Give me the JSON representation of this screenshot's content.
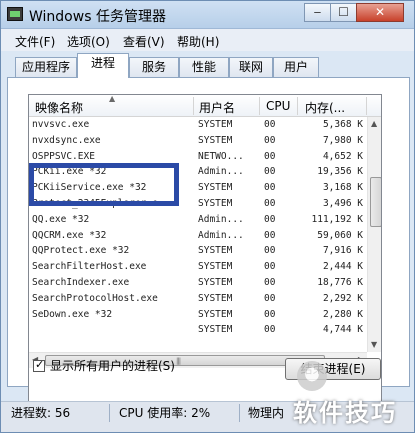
{
  "window": {
    "title": "Windows 任务管理器",
    "min": "‒",
    "max": "☐",
    "close": "✕"
  },
  "menu": [
    "文件(F)",
    "选项(O)",
    "查看(V)",
    "帮助(H)"
  ],
  "tabs": [
    "应用程序",
    "进程",
    "服务",
    "性能",
    "联网",
    "用户"
  ],
  "active_tab": "进程",
  "columns": [
    "映像名称",
    "用户名",
    "CPU",
    "内存(..."
  ],
  "rows": [
    [
      "nvvsvc.exe",
      "SYSTEM",
      "00",
      "5,368 K"
    ],
    [
      "nvxdsync.exe",
      "SYSTEM",
      "00",
      "7,980 K"
    ],
    [
      "OSPPSVC.EXE",
      "NETWO...",
      "00",
      "4,652 K"
    ],
    [
      "PCKii.exe *32",
      "Admin...",
      "00",
      "19,356 K"
    ],
    [
      "PCKiiService.exe *32",
      "SYSTEM",
      "00",
      "3,168 K"
    ],
    [
      "Protect_2345Explorer.e...",
      "SYSTEM",
      "00",
      "3,496 K"
    ],
    [
      "QQ.exe *32",
      "Admin...",
      "00",
      "111,192 K"
    ],
    [
      "QQCRM.exe *32",
      "Admin...",
      "00",
      "59,060 K"
    ],
    [
      "QQProtect.exe *32",
      "SYSTEM",
      "00",
      "7,916 K"
    ],
    [
      "SearchFilterHost.exe",
      "SYSTEM",
      "00",
      "2,444 K"
    ],
    [
      "SearchIndexer.exe",
      "SYSTEM",
      "00",
      "18,776 K"
    ],
    [
      "SearchProtocolHost.exe",
      "SYSTEM",
      "00",
      "2,292 K"
    ],
    [
      "SeDown.exe *32",
      "SYSTEM",
      "00",
      "2,280 K"
    ],
    [
      "",
      "SYSTEM",
      "00",
      "4,744 K"
    ]
  ],
  "show_all_label": "显示所有用户的进程(S)",
  "show_all_checked": true,
  "end_process_label": "结束进程(E)",
  "status": {
    "processes": "进程数: 56",
    "cpu": "CPU 使用率: 2%",
    "memory": "物理内"
  },
  "watermark": "软件技巧",
  "colors": {
    "highlight_box": "#2b4aa6",
    "titlebar": "#b7cfe9"
  }
}
